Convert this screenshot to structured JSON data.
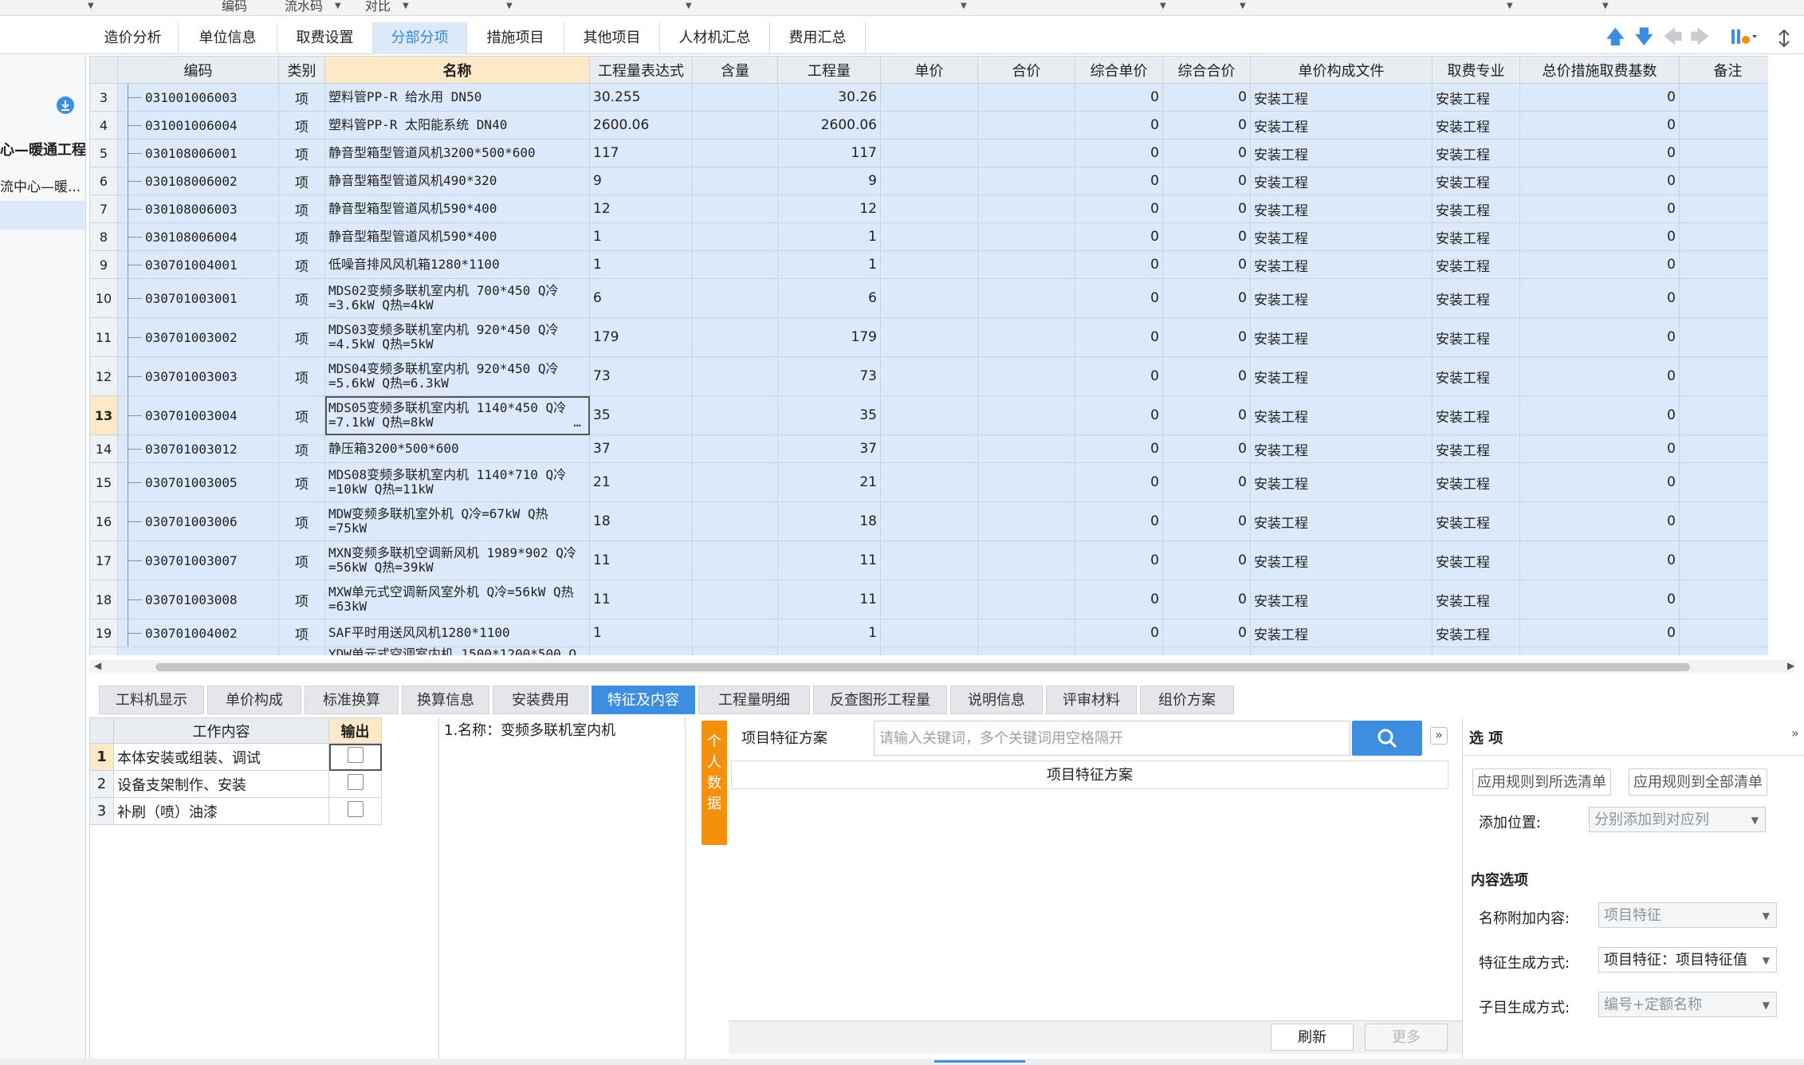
{
  "top_strip": {
    "items": [
      "编码",
      "流水码",
      "对比"
    ]
  },
  "tabs": [
    "造价分析",
    "单位信息",
    "取费设置",
    "分部分项",
    "措施项目",
    "其他项目",
    "人材机汇总",
    "费用汇总"
  ],
  "active_tab": "分部分项",
  "left_tree": {
    "items": [
      "心—暖通工程",
      "流中心—暖..."
    ]
  },
  "grid": {
    "columns": [
      "编码",
      "类别",
      "名称",
      "工程量表达式",
      "含量",
      "工程量",
      "单价",
      "合价",
      "综合单价",
      "综合合价",
      "单价构成文件",
      "取费专业",
      "总价措施取费基数",
      "备注"
    ],
    "rows": [
      {
        "n": "3",
        "code": "031001006003",
        "type": "项",
        "name": "塑料管PP-R 给水用 DN50",
        "expr": "30.255",
        "qty": "30.26",
        "up": "0",
        "ut": "0",
        "file": "安装工程",
        "spec": "安装工程",
        "base": "0",
        "tall": false
      },
      {
        "n": "4",
        "code": "031001006004",
        "type": "项",
        "name": "塑料管PP-R 太阳能系统 DN40",
        "expr": "2600.06",
        "qty": "2600.06",
        "up": "0",
        "ut": "0",
        "file": "安装工程",
        "spec": "安装工程",
        "base": "0",
        "tall": false
      },
      {
        "n": "5",
        "code": "030108006001",
        "type": "项",
        "name": "静音型箱型管道风机3200*500*600",
        "expr": "117",
        "qty": "117",
        "up": "0",
        "ut": "0",
        "file": "安装工程",
        "spec": "安装工程",
        "base": "0",
        "tall": false
      },
      {
        "n": "6",
        "code": "030108006002",
        "type": "项",
        "name": "静音型箱型管道风机490*320",
        "expr": "9",
        "qty": "9",
        "up": "0",
        "ut": "0",
        "file": "安装工程",
        "spec": "安装工程",
        "base": "0",
        "tall": false
      },
      {
        "n": "7",
        "code": "030108006003",
        "type": "项",
        "name": "静音型箱型管道风机590*400",
        "expr": "12",
        "qty": "12",
        "up": "0",
        "ut": "0",
        "file": "安装工程",
        "spec": "安装工程",
        "base": "0",
        "tall": false
      },
      {
        "n": "8",
        "code": "030108006004",
        "type": "项",
        "name": "静音型箱型管道风机590*400",
        "expr": "1",
        "qty": "1",
        "up": "0",
        "ut": "0",
        "file": "安装工程",
        "spec": "安装工程",
        "base": "0",
        "tall": false
      },
      {
        "n": "9",
        "code": "030701004001",
        "type": "项",
        "name": "低噪音排风风机箱1280*1100",
        "expr": "1",
        "qty": "1",
        "up": "0",
        "ut": "0",
        "file": "安装工程",
        "spec": "安装工程",
        "base": "0",
        "tall": false
      },
      {
        "n": "10",
        "code": "030701003001",
        "type": "项",
        "name": "MDS02变频多联机室内机 700*450 Q冷=3.6kW Q热=4kW",
        "expr": "6",
        "qty": "6",
        "up": "0",
        "ut": "0",
        "file": "安装工程",
        "spec": "安装工程",
        "base": "0",
        "tall": true
      },
      {
        "n": "11",
        "code": "030701003002",
        "type": "项",
        "name": "MDS03变频多联机室内机 920*450 Q冷=4.5kW Q热=5kW",
        "expr": "179",
        "qty": "179",
        "up": "0",
        "ut": "0",
        "file": "安装工程",
        "spec": "安装工程",
        "base": "0",
        "tall": true
      },
      {
        "n": "12",
        "code": "030701003003",
        "type": "项",
        "name": "MDS04变频多联机室内机 920*450 Q冷=5.6kW Q热=6.3kW",
        "expr": "73",
        "qty": "73",
        "up": "0",
        "ut": "0",
        "file": "安装工程",
        "spec": "安装工程",
        "base": "0",
        "tall": true
      },
      {
        "n": "13",
        "code": "030701003004",
        "type": "项",
        "name": "MDS05变频多联机室内机 1140*450 Q冷=7.1kW Q热=8kW",
        "expr": "35",
        "qty": "35",
        "up": "0",
        "ut": "0",
        "file": "安装工程",
        "spec": "安装工程",
        "base": "0",
        "tall": true,
        "current": true
      },
      {
        "n": "14",
        "code": "030701003012",
        "type": "项",
        "name": "静压箱3200*500*600",
        "expr": "37",
        "qty": "37",
        "up": "0",
        "ut": "0",
        "file": "安装工程",
        "spec": "安装工程",
        "base": "0",
        "tall": false
      },
      {
        "n": "15",
        "code": "030701003005",
        "type": "项",
        "name": "MDS08变频多联机室内机 1140*710 Q冷=10kW Q热=11kW",
        "expr": "21",
        "qty": "21",
        "up": "0",
        "ut": "0",
        "file": "安装工程",
        "spec": "安装工程",
        "base": "0",
        "tall": true
      },
      {
        "n": "16",
        "code": "030701003006",
        "type": "项",
        "name": "MDW变频多联机室外机 Q冷=67kW Q热=75kW",
        "expr": "18",
        "qty": "18",
        "up": "0",
        "ut": "0",
        "file": "安装工程",
        "spec": "安装工程",
        "base": "0",
        "tall": true
      },
      {
        "n": "17",
        "code": "030701003007",
        "type": "项",
        "name": "MXN变频多联机空调新风机 1989*902 Q冷=56kW Q热=39kW",
        "expr": "11",
        "qty": "11",
        "up": "0",
        "ut": "0",
        "file": "安装工程",
        "spec": "安装工程",
        "base": "0",
        "tall": true
      },
      {
        "n": "18",
        "code": "030701003008",
        "type": "项",
        "name": "MXW单元式空调新风室外机 Q冷=56kW Q热=63kW",
        "expr": "11",
        "qty": "11",
        "up": "0",
        "ut": "0",
        "file": "安装工程",
        "spec": "安装工程",
        "base": "0",
        "tall": true
      },
      {
        "n": "19",
        "code": "030701004002",
        "type": "项",
        "name": "SAF平时用送风风机1280*1100",
        "expr": "1",
        "qty": "1",
        "up": "0",
        "ut": "0",
        "file": "安装工程",
        "spec": "安装工程",
        "base": "0",
        "tall": false
      }
    ],
    "partial_row_name": "YDW单元式空调室内机 1500*1200*500 Q"
  },
  "bottom_tabs": [
    "工料机显示",
    "单价构成",
    "标准换算",
    "换算信息",
    "安装费用",
    "特征及内容",
    "工程量明细",
    "反查图形工程量",
    "说明信息",
    "评审材料",
    "组价方案"
  ],
  "bottom_active": "特征及内容",
  "work": {
    "headers": [
      "工作内容",
      "输出"
    ],
    "rows": [
      {
        "n": "1",
        "text": "本体安装或组装、调试"
      },
      {
        "n": "2",
        "text": "设备支架制作、安装"
      },
      {
        "n": "3",
        "text": "补刷（喷）油漆"
      }
    ]
  },
  "feature_text": "1.名称：变频多联机室内机",
  "personal_data_label": "个人数据",
  "feat": {
    "label": "项目特征方案",
    "placeholder": "请输入关键词，多个关键词用空格隔开",
    "table_header": "项目特征方案",
    "refresh": "刷新",
    "more": "更多"
  },
  "options": {
    "title": "选 项",
    "apply_selected": "应用规则到所选清单",
    "apply_all": "应用规则到全部清单",
    "add_pos_label": "添加位置:",
    "add_pos_value": "分别添加到对应列",
    "content_title": "内容选项",
    "name_add_label": "名称附加内容:",
    "name_add_value": "项目特征",
    "feat_gen_label": "特征生成方式:",
    "feat_gen_value": "项目特征：项目特征值",
    "sub_gen_label": "子目生成方式:",
    "sub_gen_value": "编号+定额名称"
  },
  "colors": {
    "accent": "#3d8ee0",
    "row_bg": "#dce9fb",
    "header_hl": "#fde8c7",
    "orange": "#f4900c"
  }
}
